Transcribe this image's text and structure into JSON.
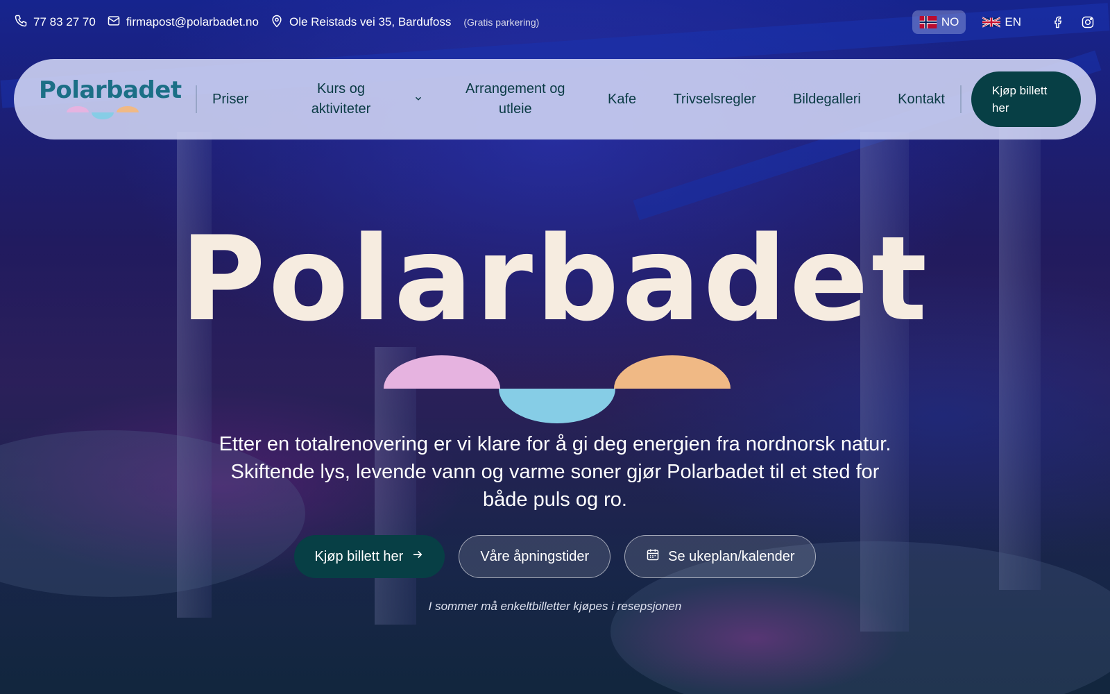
{
  "topbar": {
    "phone": "77 83 27 70",
    "email": "firmapost@polarbadet.no",
    "address": "Ole Reistads vei 35, Bardufoss",
    "address_note": "(Gratis parkering)",
    "languages": [
      {
        "code": "NO",
        "active": true
      },
      {
        "code": "EN",
        "active": false
      }
    ],
    "social": [
      "facebook-icon",
      "instagram-icon"
    ]
  },
  "nav": {
    "logo_text": "Polarbadet",
    "items": [
      {
        "label": "Priser"
      },
      {
        "label": "Kurs og aktiviteter",
        "has_dropdown": true
      },
      {
        "label": "Arrangement og utleie"
      },
      {
        "label": "Kafe"
      },
      {
        "label": "Trivselsregler"
      },
      {
        "label": "Bildegalleri"
      },
      {
        "label": "Kontakt"
      }
    ],
    "cta": "Kjøp billett her"
  },
  "hero": {
    "title": "Polarbadet",
    "text": "Etter en totalrenovering er vi klare for å gi deg energien fra nordnorsk natur. Skiftende lys, levende vann og varme soner gjør Polarbadet til et sted for både puls og ro.",
    "buttons": {
      "buy": "Kjøp billett her",
      "hours": "Våre åpningstider",
      "calendar": "Se ukeplan/kalender"
    },
    "footnote": "I sommer må enkeltbilletter kjøpes i resepsjonen"
  },
  "colors": {
    "brand_dark": "#073f45",
    "logo_blue": "#1b6f86",
    "pink": "#e6b3e0",
    "cyan": "#86cde6",
    "peach": "#f0b985",
    "title_cream": "#f6ece0"
  }
}
